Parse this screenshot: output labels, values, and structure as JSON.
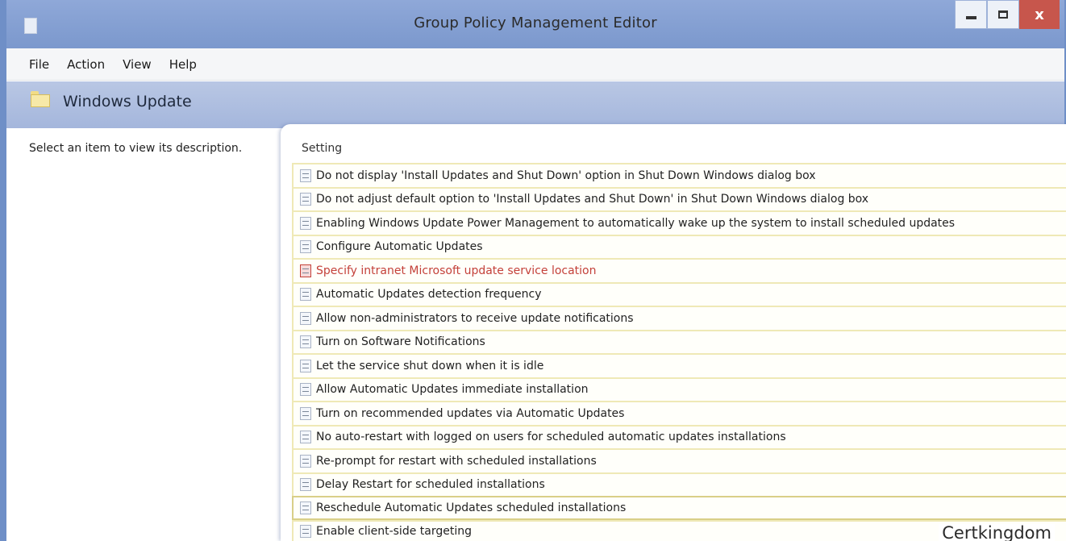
{
  "window": {
    "title": "Group Policy Management Editor",
    "controls": {
      "minimize": "−",
      "maximize": "□",
      "close": "x"
    }
  },
  "menu": {
    "items": [
      {
        "label": "File"
      },
      {
        "label": "Action"
      },
      {
        "label": "View"
      },
      {
        "label": "Help"
      }
    ]
  },
  "banner": {
    "title": "Windows Update",
    "icon": "folder-icon"
  },
  "left_pane": {
    "description": "Select an item to view its description."
  },
  "settings": {
    "column_header": "Setting",
    "items": [
      {
        "label": "Do not display 'Install Updates and Shut Down' option in Shut Down Windows dialog box"
      },
      {
        "label": "Do not adjust default option to 'Install Updates and Shut Down' in Shut Down Windows dialog box"
      },
      {
        "label": "Enabling Windows Update Power Management to automatically wake up the system to install scheduled updates"
      },
      {
        "label": "Configure Automatic Updates"
      },
      {
        "label": "Specify intranet Microsoft update service location"
      },
      {
        "label": "Automatic Updates detection frequency"
      },
      {
        "label": "Allow non-administrators to receive update notifications"
      },
      {
        "label": "Turn on Software Notifications"
      },
      {
        "label": "Let the service shut down when it is idle"
      },
      {
        "label": "Allow Automatic Updates immediate installation"
      },
      {
        "label": "Turn on recommended updates via Automatic Updates"
      },
      {
        "label": "No auto-restart with logged on users for scheduled automatic updates installations"
      },
      {
        "label": "Re-prompt for restart with scheduled installations"
      },
      {
        "label": "Delay Restart for scheduled installations"
      },
      {
        "label": "Reschedule Automatic Updates scheduled installations"
      },
      {
        "label": "Enable client-side targeting"
      }
    ]
  },
  "watermark": "Certkingdom",
  "colors": {
    "titlebar": "#7b98cd",
    "banner": "#a4b6dc",
    "row_border": "#efe9b6",
    "highlight_text": "#c4413a",
    "close_button": "#c7564c"
  }
}
